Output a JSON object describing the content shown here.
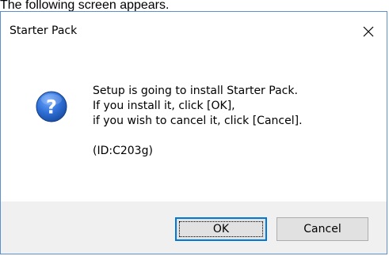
{
  "caption": "The following screen appears.",
  "dialog": {
    "title": "Starter Pack",
    "close_icon": "close-icon",
    "icon": "question-icon",
    "message_lines": [
      "Setup is going to install Starter Pack.",
      "If you install it, click [OK],",
      "if you wish to cancel it, click [Cancel]."
    ],
    "id_text": "(ID:C203g)",
    "buttons": {
      "ok_label": "OK",
      "cancel_label": "Cancel"
    }
  },
  "colors": {
    "accent": "#0078d7",
    "icon_blue": "#1e5bb8",
    "footer_bg": "#f0f0f0",
    "button_bg": "#e1e1e1",
    "button_border": "#adadad"
  }
}
